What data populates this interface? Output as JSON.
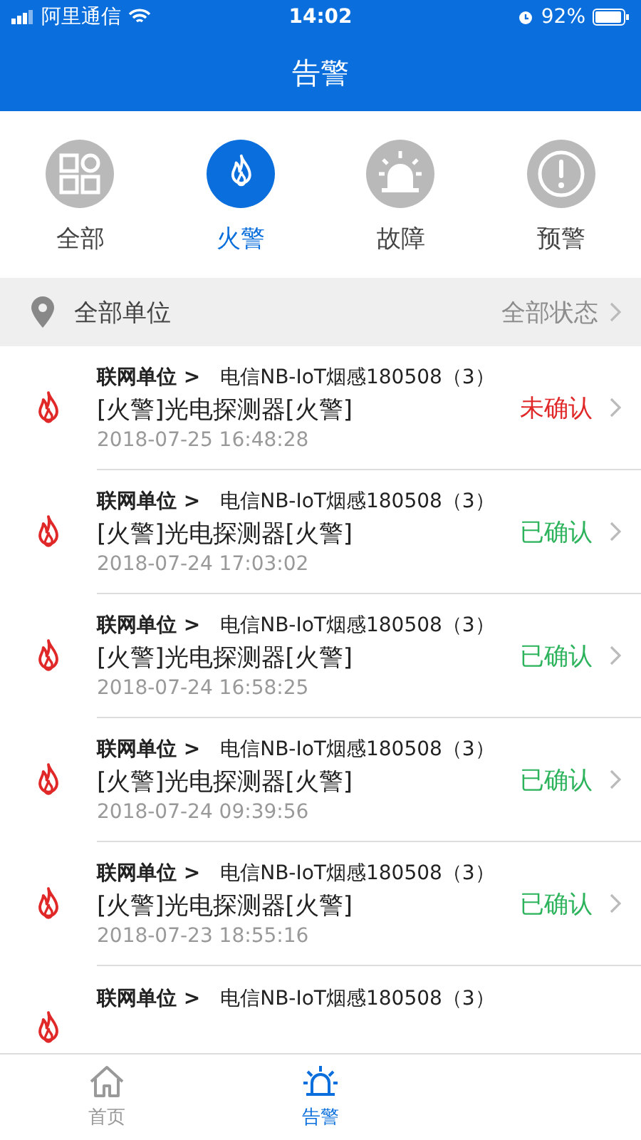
{
  "status_bar": {
    "carrier": "阿里通信",
    "time": "14:02",
    "battery": "92%"
  },
  "nav": {
    "title": "告警"
  },
  "categories": [
    {
      "label": "全部",
      "kind": "all",
      "selected": false
    },
    {
      "label": "火警",
      "kind": "fire",
      "selected": true
    },
    {
      "label": "故障",
      "kind": "fault",
      "selected": false
    },
    {
      "label": "预警",
      "kind": "warning",
      "selected": false
    }
  ],
  "filter": {
    "unit": "全部单位",
    "status": "全部状态"
  },
  "alarms": [
    {
      "unit_label": "联网单位 >",
      "device": "电信NB-IoT烟感180508（3）",
      "title": "[火警]光电探测器[火警]",
      "time": "2018-07-25 16:48:28",
      "status": "未确认",
      "confirmed": false
    },
    {
      "unit_label": "联网单位 >",
      "device": "电信NB-IoT烟感180508（3）",
      "title": "[火警]光电探测器[火警]",
      "time": "2018-07-24 17:03:02",
      "status": "已确认",
      "confirmed": true
    },
    {
      "unit_label": "联网单位 >",
      "device": "电信NB-IoT烟感180508（3）",
      "title": "[火警]光电探测器[火警]",
      "time": "2018-07-24 16:58:25",
      "status": "已确认",
      "confirmed": true
    },
    {
      "unit_label": "联网单位 >",
      "device": "电信NB-IoT烟感180508（3）",
      "title": "[火警]光电探测器[火警]",
      "time": "2018-07-24 09:39:56",
      "status": "已确认",
      "confirmed": true
    },
    {
      "unit_label": "联网单位 >",
      "device": "电信NB-IoT烟感180508（3）",
      "title": "[火警]光电探测器[火警]",
      "time": "2018-07-23 18:55:16",
      "status": "已确认",
      "confirmed": true
    },
    {
      "unit_label": "联网单位 >",
      "device": "电信NB-IoT烟感180508（3）"
    }
  ],
  "tab_bar": [
    {
      "label": "首页",
      "kind": "home",
      "selected": false
    },
    {
      "label": "告警",
      "kind": "alarm",
      "selected": true
    }
  ]
}
